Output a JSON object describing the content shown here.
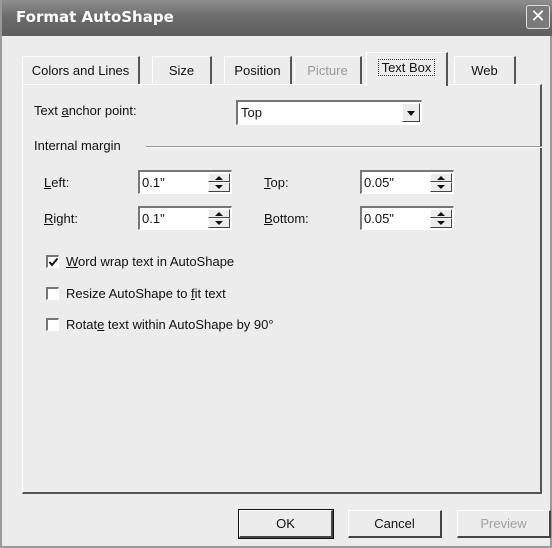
{
  "window": {
    "title": "Format AutoShape",
    "close_glyph": "✕"
  },
  "tabs": [
    {
      "label": "Colors and Lines",
      "state": "normal"
    },
    {
      "label": "Size",
      "state": "normal"
    },
    {
      "label": "Position",
      "state": "normal"
    },
    {
      "label": "Picture",
      "state": "disabled"
    },
    {
      "label": "Text Box",
      "state": "active"
    },
    {
      "label": "Web",
      "state": "normal"
    }
  ],
  "anchor": {
    "label_before": "Text ",
    "label_mnemonic": "a",
    "label_after": "nchor point:",
    "value": "Top"
  },
  "internal_margin": {
    "heading": "Internal margin",
    "left": {
      "mnemonic": "L",
      "rest": "eft:",
      "value": "0.1\""
    },
    "right": {
      "mnemonic": "R",
      "rest": "ight:",
      "value": "0.1\""
    },
    "top": {
      "mnemonic": "T",
      "rest": "op:",
      "value": "0.05\""
    },
    "bottom": {
      "mnemonic": "B",
      "rest": "ottom:",
      "value": "0.05\""
    }
  },
  "options": {
    "word_wrap": {
      "before": "",
      "mnemonic": "W",
      "after": "ord wrap text in AutoShape",
      "checked": true
    },
    "resize": {
      "before": "Resize AutoShape to ",
      "mnemonic": "f",
      "after": "it text",
      "checked": false
    },
    "rotate": {
      "before": "Rotat",
      "mnemonic": "e",
      "after": " text within AutoShape by 90°",
      "checked": false
    }
  },
  "buttons": {
    "ok": "OK",
    "cancel": "Cancel",
    "preview": "Preview"
  },
  "icons": {
    "close": "close-icon",
    "dropdown": "chevron-down-icon",
    "spin_up": "spin-up-icon",
    "spin_down": "spin-down-icon",
    "check": "checkmark-icon"
  },
  "colors": {
    "titlebar": "#6a6a6a",
    "face": "#ececec",
    "disabled_text": "#9a9a9a"
  }
}
